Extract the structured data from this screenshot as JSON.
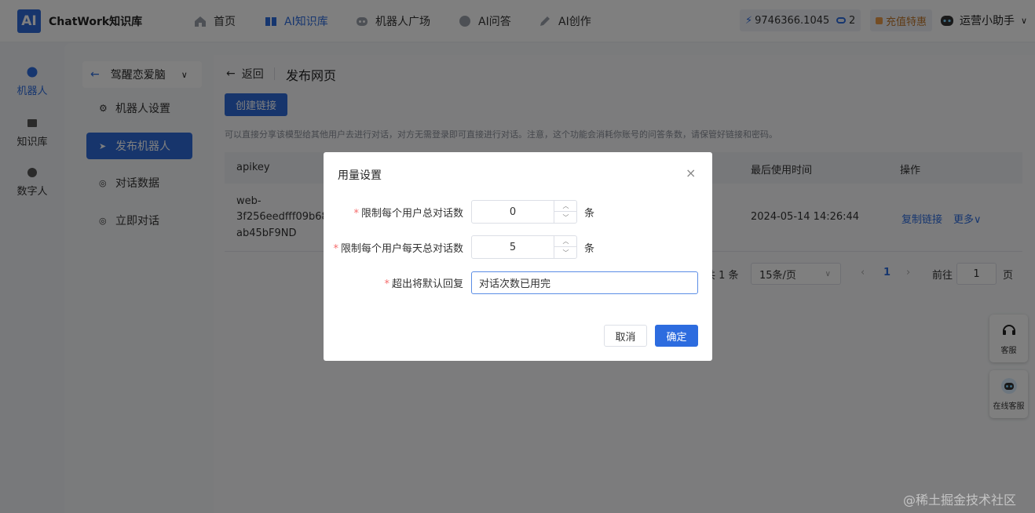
{
  "app": {
    "logo_text": "AI",
    "brand": "ChatWork知识库"
  },
  "nav": {
    "items": [
      {
        "label": "首页",
        "icon": "home-icon"
      },
      {
        "label": "AI知识库",
        "icon": "book-icon",
        "active": true
      },
      {
        "label": "机器人广场",
        "icon": "robot-icon"
      },
      {
        "label": "AI问答",
        "icon": "chat-bubble-icon"
      },
      {
        "label": "AI创作",
        "icon": "pen-icon"
      }
    ],
    "balance": "9746366.1045",
    "coupon_count": "2",
    "recharge": "充值特惠",
    "user": "运营小助手"
  },
  "rail": {
    "items": [
      {
        "label": "机器人",
        "active": true
      },
      {
        "label": "知识库"
      },
      {
        "label": "数字人"
      }
    ]
  },
  "subnav": {
    "bot_name": "驾醒恋爱脑",
    "items": [
      {
        "label": "机器人设置"
      },
      {
        "label": "发布机器人",
        "active": true
      },
      {
        "label": "对话数据"
      },
      {
        "label": "立即对话"
      }
    ]
  },
  "page": {
    "back": "返回",
    "title": "发布网页",
    "create_button": "创建链接",
    "hint": "可以直接分享该模型给其他用户去进行对话，对方无需登录即可直接进行对话。注意，这个功能会消耗你账号的问答条数，请保管好链接和密码。"
  },
  "table": {
    "headers": {
      "apikey": "apikey",
      "last_used": "最后使用时间",
      "actions": "操作"
    },
    "row": {
      "apikey_line1": "web-",
      "apikey_line2": "3f256eedfff09b68c1",
      "apikey_line3": "ab45bF9ND",
      "last_used": "2024-05-14 14:26:44",
      "copy_link": "复制链接",
      "more": "更多∨"
    }
  },
  "pager": {
    "total": "共 1 条",
    "page_size": "15条/页",
    "current": "1",
    "goto_label": "前往",
    "goto_value": "1",
    "page_unit": "页",
    "prev": "‹",
    "next": "›"
  },
  "dialog": {
    "title": "用量设置",
    "close": "×",
    "total_label": "限制每个用户总对话数",
    "total_value": "0",
    "daily_label": "限制每个用户每天总对话数",
    "daily_value": "5",
    "unit": "条",
    "reply_label": "超出将默认回复",
    "reply_value": "对话次数已用完",
    "cancel": "取消",
    "confirm": "确定"
  },
  "floats": {
    "service": "客服",
    "online_service": "在线客服"
  },
  "watermark": "@稀土掘金技术社区",
  "colors": {
    "accent": "#2d6cdf",
    "required": "#f56c6c"
  }
}
